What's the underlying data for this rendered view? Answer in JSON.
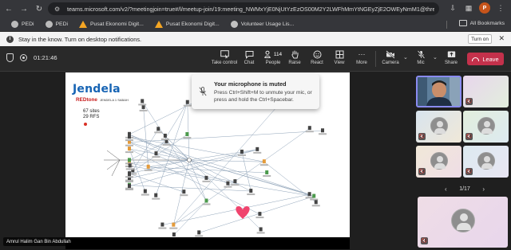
{
  "browser": {
    "url": "teams.microsoft.com/v2/?meetingjoin=true#/l/meetup-join/19:meeting_NWMxYjE0NjUtYzEzOS00M2Y2LWFhMmYtNGEyZjE2OWEyNmM1@thread.v...",
    "profile_initial": "P",
    "icons": [
      "back-icon",
      "forward-icon",
      "reload-icon",
      "site-info-icon",
      "download-icon",
      "extensions-icon",
      "more-icon"
    ]
  },
  "bookmarks": {
    "items": [
      {
        "label": "PEDi",
        "icon": "globe-icon"
      },
      {
        "label": "PEDi",
        "icon": "globe-icon"
      },
      {
        "label": "Pusat Ekonomi Digit...",
        "icon": "warning-triangle-icon"
      },
      {
        "label": "Pusat Ekonomi Digit...",
        "icon": "warning-triangle-icon"
      },
      {
        "label": "Volunteer Usage Lis...",
        "icon": "people-icon"
      }
    ],
    "all_label": "All Bookmarks"
  },
  "notification": {
    "text": "Stay in the know. Turn on desktop notifications.",
    "turn_on_label": "Turn on"
  },
  "toolbar": {
    "timer": "01:21:46",
    "buttons": {
      "take_control": "Take control",
      "chat": "Chat",
      "people": "People",
      "people_count": "114",
      "raise": "Raise",
      "react": "React",
      "view": "View",
      "more": "More",
      "camera": "Camera",
      "mic": "Mic",
      "share": "Share"
    },
    "leave_label": "Leave"
  },
  "slide": {
    "logo_title": "Jendela",
    "logo_sub": "REDtone",
    "logo_note": "JENDELA 1 SABAH",
    "stats_line1": "67 sites",
    "stats_line2": "29 RFS"
  },
  "toast": {
    "title": "Your microphone is muted",
    "message": "Press Ctrl+Shift+M to unmute your mic, or press and hold the Ctrl+Spacebar."
  },
  "presenter_name": "Amrul Halim Gan Bin Abdullah",
  "participants": {
    "pager": "1/17",
    "tile_colors": [
      "#e8d6ec",
      "#d8e4ee",
      "#e2eedd",
      "#f0e8d8",
      "#ddeaf0",
      "#efdde6",
      "#e8e6f3"
    ]
  }
}
